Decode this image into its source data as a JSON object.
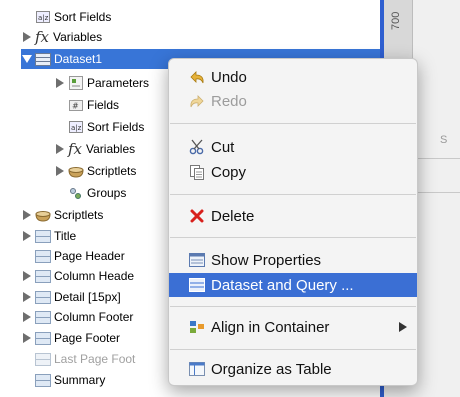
{
  "tree": {
    "items": [
      {
        "label": "Sort Fields",
        "icon": "sort-fields-icon",
        "expander": "none"
      },
      {
        "label": "Variables",
        "icon": "fx-icon",
        "expander": "collapsed"
      },
      {
        "label": "Dataset1",
        "icon": "dataset-icon",
        "expander": "expanded",
        "selected": true
      },
      {
        "label": "Parameters",
        "icon": "parameters-icon",
        "expander": "collapsed"
      },
      {
        "label": "Fields",
        "icon": "fields-icon",
        "expander": "none"
      },
      {
        "label": "Sort Fields",
        "icon": "sort-fields-icon",
        "expander": "none"
      },
      {
        "label": "Variables",
        "icon": "fx-icon",
        "expander": "collapsed"
      },
      {
        "label": "Scriptlets",
        "icon": "scriptlet-icon",
        "expander": "collapsed"
      },
      {
        "label": "Groups",
        "icon": "groups-icon",
        "expander": "none"
      },
      {
        "label": "Scriptlets",
        "icon": "scriptlet-icon",
        "expander": "collapsed"
      },
      {
        "label": "Title",
        "icon": "band-icon",
        "expander": "collapsed"
      },
      {
        "label": "Page Header",
        "icon": "band-icon",
        "expander": "none"
      },
      {
        "label": "Column Heade",
        "icon": "band-icon",
        "expander": "collapsed"
      },
      {
        "label": "Detail [15px]",
        "icon": "band-icon",
        "expander": "collapsed"
      },
      {
        "label": "Column Footer",
        "icon": "band-icon",
        "expander": "collapsed"
      },
      {
        "label": "Page Footer",
        "icon": "band-icon",
        "expander": "collapsed"
      },
      {
        "label": "Last Page Foot",
        "icon": "band-icon",
        "expander": "none",
        "disabled": true
      },
      {
        "label": "Summary",
        "icon": "band-icon",
        "expander": "none"
      }
    ]
  },
  "ruler": {
    "value": "700"
  },
  "right_panel": {
    "fragment": "S"
  },
  "context_menu": {
    "items": [
      {
        "label": "Undo",
        "icon": "undo-icon",
        "disabled": false
      },
      {
        "label": "Redo",
        "icon": "redo-icon",
        "disabled": true
      },
      {
        "label": "Cut",
        "icon": "scissors-icon",
        "disabled": false
      },
      {
        "label": "Copy",
        "icon": "copy-icon",
        "disabled": false
      },
      {
        "label": "Delete",
        "icon": "delete-icon",
        "disabled": false
      },
      {
        "label": "Show Properties",
        "icon": "properties-icon",
        "disabled": false
      },
      {
        "label": "Dataset and Query ...",
        "icon": "dataset-query-icon",
        "disabled": false,
        "highlighted": true
      },
      {
        "label": "Align in Container",
        "icon": "align-container-icon",
        "disabled": false,
        "submenu": true
      },
      {
        "label": "Organize as Table",
        "icon": "table-icon",
        "disabled": false
      }
    ]
  },
  "colors": {
    "selection": "#3875d7",
    "menu_highlight": "#3b6fd4",
    "delete_red": "#d8201c"
  }
}
